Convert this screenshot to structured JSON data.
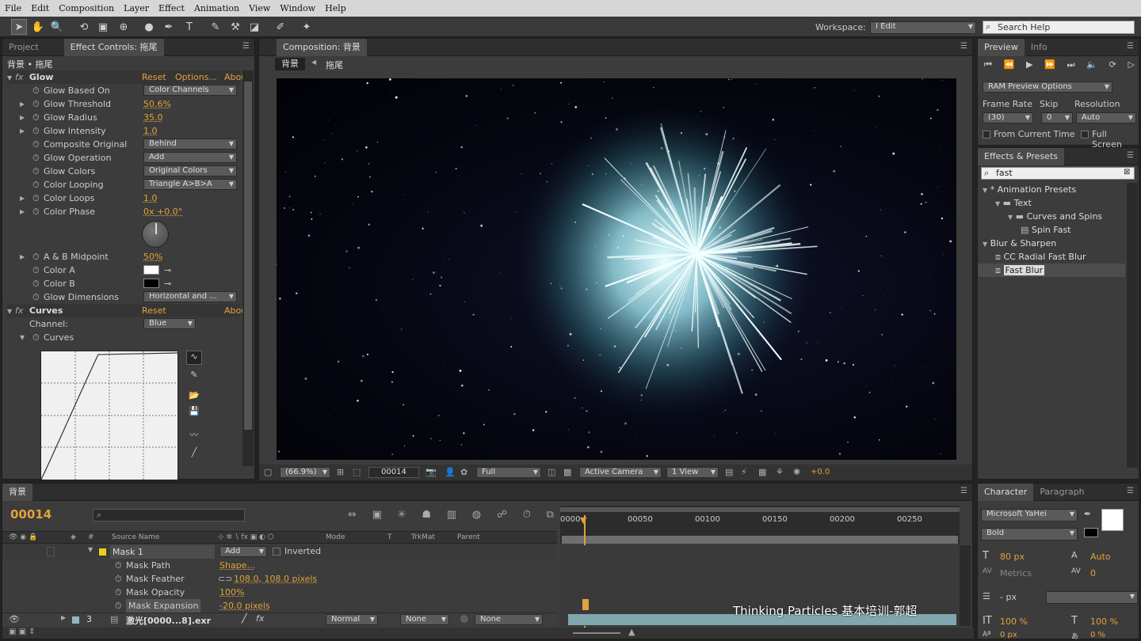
{
  "menu": [
    "File",
    "Edit",
    "Composition",
    "Layer",
    "Effect",
    "Animation",
    "View",
    "Window",
    "Help"
  ],
  "toolbar": {
    "workspace_label": "Workspace:",
    "workspace_value": "I Edit",
    "search_placeholder": "Search Help"
  },
  "project_tab": "Project",
  "effect_controls": {
    "tab": "Effect Controls: 拖尾",
    "path": "背景 • 拖尾",
    "glow": {
      "name": "Glow",
      "reset": "Reset",
      "options": "Options...",
      "about": "Abou"
    },
    "props": [
      {
        "label": "Glow Based On",
        "value": "Color Channels",
        "kind": "dd",
        "tri": false
      },
      {
        "label": "Glow Threshold",
        "value": "50.6%",
        "kind": "num",
        "tri": true
      },
      {
        "label": "Glow Radius",
        "value": "35.0",
        "kind": "num",
        "tri": true
      },
      {
        "label": "Glow Intensity",
        "value": "1.0",
        "kind": "num",
        "tri": true
      },
      {
        "label": "Composite Original",
        "value": "Behind",
        "kind": "dd",
        "tri": false
      },
      {
        "label": "Glow Operation",
        "value": "Add",
        "kind": "dd",
        "tri": false
      },
      {
        "label": "Glow Colors",
        "value": "Original Colors",
        "kind": "dd",
        "tri": false
      },
      {
        "label": "Color Looping",
        "value": "Triangle A>B>A",
        "kind": "dd",
        "tri": false
      },
      {
        "label": "Color Loops",
        "value": "1.0",
        "kind": "num",
        "tri": true
      },
      {
        "label": "Color Phase",
        "value": "0x +0.0°",
        "kind": "num",
        "tri": true
      }
    ],
    "props2": [
      {
        "label": "A & B Midpoint",
        "value": "50%",
        "kind": "num"
      },
      {
        "label": "Color A",
        "value": "",
        "kind": "colorA"
      },
      {
        "label": "Color B",
        "value": "",
        "kind": "colorB"
      },
      {
        "label": "Glow Dimensions",
        "value": "Horizontal and ...",
        "kind": "dd"
      }
    ],
    "curves": {
      "name": "Curves",
      "reset": "Reset",
      "about": "Abou",
      "channel_label": "Channel:",
      "channel_value": "Blue",
      "sub": "Curves"
    }
  },
  "composition": {
    "tab": "Composition: 背景",
    "crumb1": "背景",
    "crumb2": "拖尾",
    "zoom": "(66.9%)",
    "frame": "00014",
    "resolution": "Full",
    "camera": "Active Camera",
    "views": "1 View",
    "exposure": "+0.0"
  },
  "preview": {
    "tab": "Preview",
    "info_tab": "Info",
    "options": "RAM Preview Options",
    "frame_rate_label": "Frame Rate",
    "skip_label": "Skip",
    "resolution_label": "Resolution",
    "frame_rate": "(30)",
    "skip": "0",
    "resolution": "Auto",
    "from_current": "From Current Time",
    "full_screen": "Full Screen"
  },
  "effects_presets": {
    "tab": "Effects & Presets",
    "search": "fast",
    "items": [
      {
        "label": "* Animation Presets",
        "level": 0,
        "type": "folder-open"
      },
      {
        "label": "Text",
        "level": 1,
        "type": "folder"
      },
      {
        "label": "Curves and Spins",
        "level": 2,
        "type": "folder"
      },
      {
        "label": "Spin Fast",
        "level": 3,
        "type": "preset"
      },
      {
        "label": "Blur & Sharpen",
        "level": 0,
        "type": "folder-open"
      },
      {
        "label": "CC Radial Fast Blur",
        "level": 1,
        "type": "effect"
      },
      {
        "label": "Fast Blur",
        "level": 1,
        "type": "effect-selected"
      }
    ]
  },
  "timeline": {
    "tab": "背景",
    "timecode": "00014",
    "col_source": "Source Name",
    "col_mode": "Mode",
    "col_t": "T",
    "col_trkmat": "TrkMat",
    "col_parent": "Parent",
    "ruler": [
      "0000",
      "00050",
      "00100",
      "00150",
      "00200",
      "00250"
    ],
    "mask": {
      "name": "Mask 1",
      "mode": "Add",
      "inverted": "Inverted"
    },
    "mask_props": [
      {
        "label": "Mask Path",
        "value": "Shape..."
      },
      {
        "label": "Mask Feather",
        "value": "108.0, 108.0 pixels"
      },
      {
        "label": "Mask Opacity",
        "value": "100%"
      },
      {
        "label": "Mask Expansion",
        "value": "-20.0 pixels"
      }
    ],
    "layer": {
      "num": "3",
      "name": "激光[0000...8].exr",
      "mode": "Normal",
      "trkmat": "None",
      "parent": "None"
    },
    "watermark": "Thinking Particles 基本培训-郭超"
  },
  "character": {
    "tab": "Character",
    "para_tab": "Paragraph",
    "font": "Microsoft YaHei",
    "style": "Bold",
    "size": "80 px",
    "leading": "Auto",
    "kerning": "Metrics",
    "tracking": "0",
    "stroke": "- px",
    "vscale": "100 %",
    "hscale": "100 %",
    "baseline": "0 px",
    "tsume": "0 %"
  }
}
